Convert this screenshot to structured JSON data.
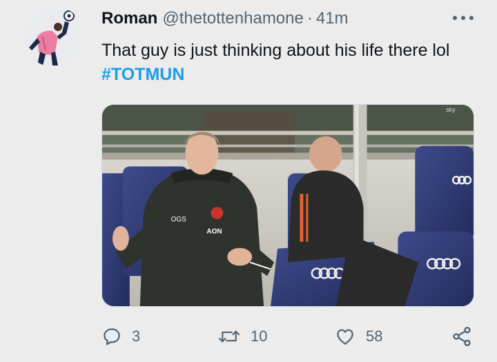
{
  "tweet": {
    "display_name": "Roman",
    "handle": "@thetottenhamone",
    "separator": "·",
    "time": "41m",
    "text_plain": "That guy is just thinking about his life there lol ",
    "hashtag": "#TOTMUN",
    "hashtag_color": "#1d9bf0"
  },
  "media": {
    "jacket_badge": "OGS",
    "sponsor": "AON",
    "seat_logo": "OOOO",
    "broadcaster": "sky"
  },
  "actions": {
    "reply_count": "3",
    "retweet_count": "10",
    "like_count": "58",
    "reply_icon": "speech-bubble-icon",
    "retweet_icon": "retweet-arrows-icon",
    "like_icon": "heart-icon",
    "share_icon": "share-nodes-icon"
  },
  "colors": {
    "background": "#ececec",
    "text": "#0f1419",
    "secondary": "#536471",
    "accent": "#1d9bf0"
  }
}
